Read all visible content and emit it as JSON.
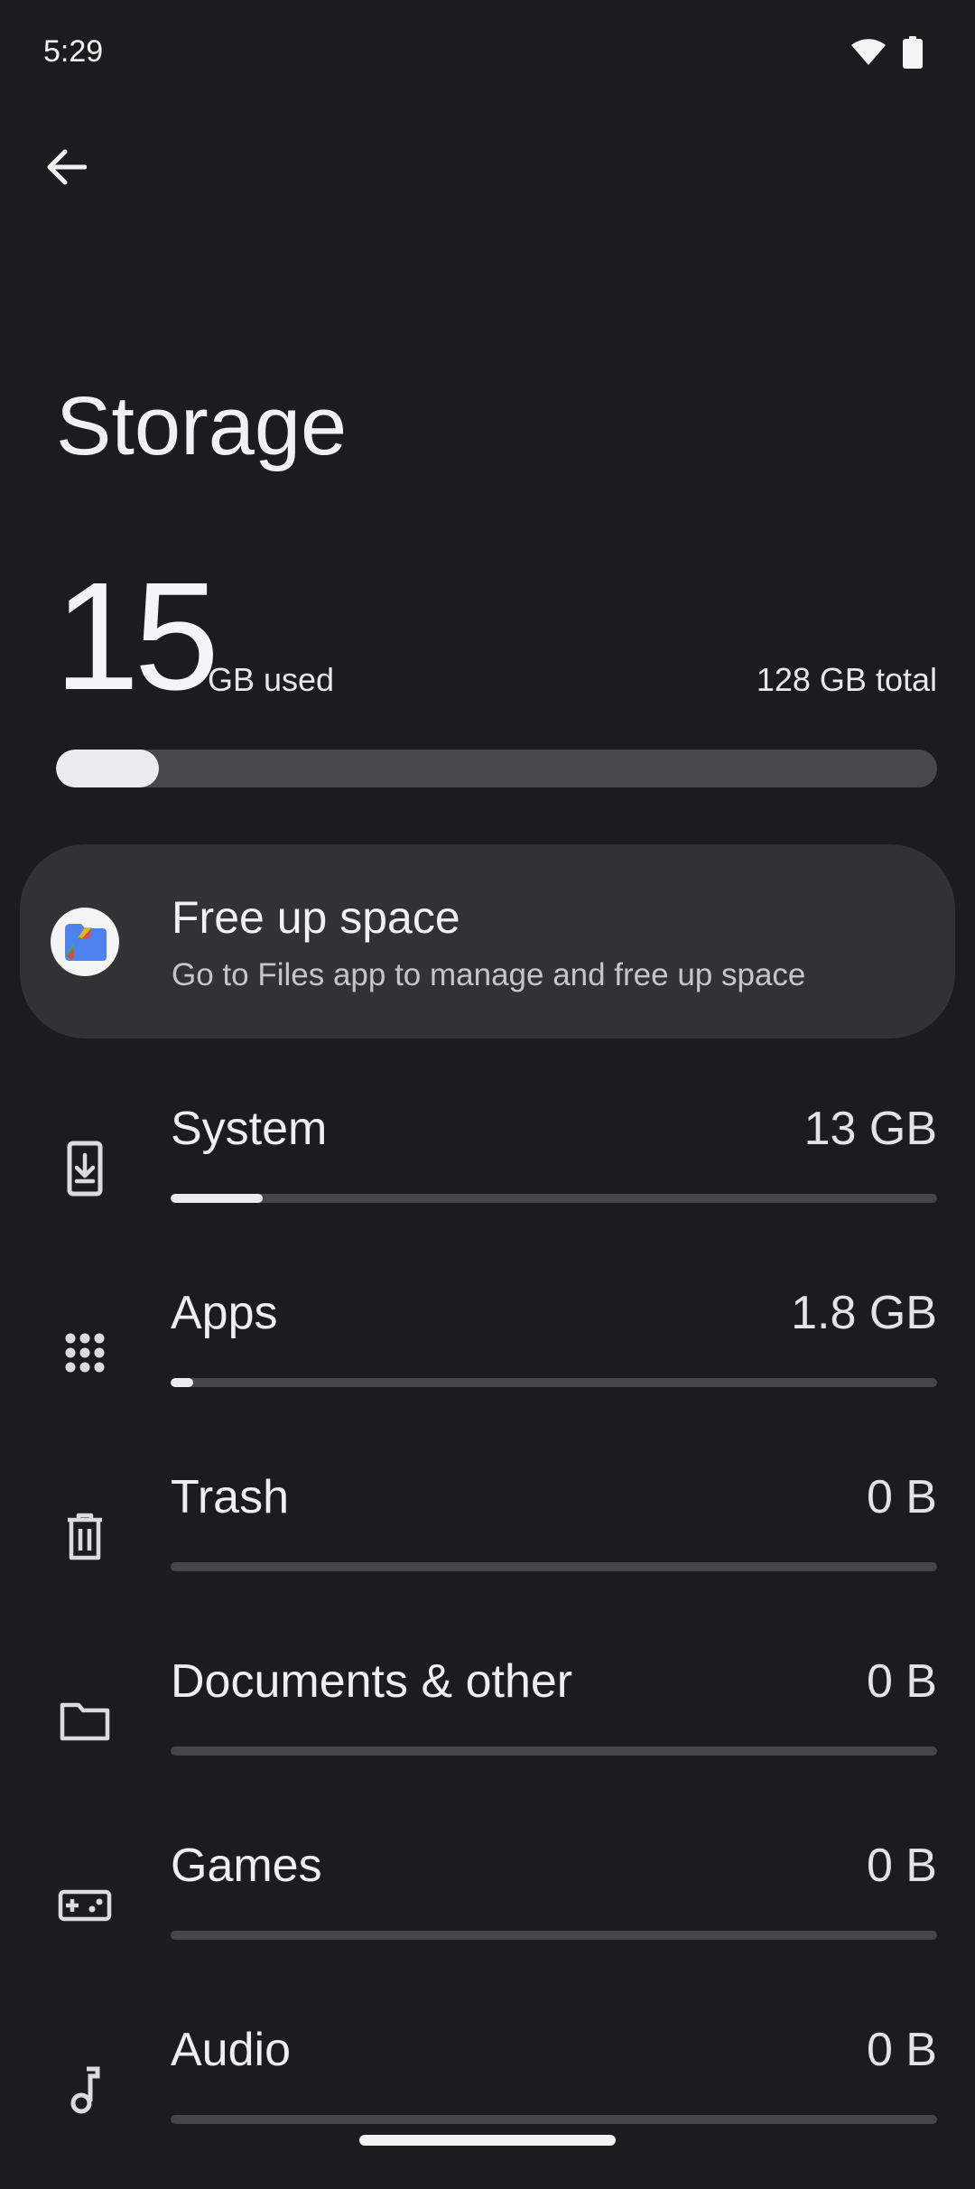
{
  "status_bar": {
    "time": "5:29",
    "icons": [
      "wifi-icon",
      "battery-icon"
    ]
  },
  "nav": {
    "back_icon": "arrow-back-icon"
  },
  "page": {
    "title": "Storage"
  },
  "usage": {
    "used_value": "15",
    "used_unit": "GB used",
    "total": "128 GB total",
    "used_fraction": 0.117
  },
  "free_up": {
    "title": "Free up space",
    "subtitle": "Go to Files app to manage and free up space",
    "icon": "files-app-icon"
  },
  "categories": [
    {
      "label": "System",
      "size": "13 GB",
      "fraction": 0.12,
      "icon": "system-update-icon"
    },
    {
      "label": "Apps",
      "size": "1.8 GB",
      "fraction": 0.03,
      "icon": "apps-grid-icon"
    },
    {
      "label": "Trash",
      "size": "0 B",
      "fraction": 0,
      "icon": "trash-icon"
    },
    {
      "label": "Documents & other",
      "size": "0 B",
      "fraction": 0,
      "icon": "folder-icon"
    },
    {
      "label": "Games",
      "size": "0 B",
      "fraction": 0,
      "icon": "gamepad-icon"
    },
    {
      "label": "Audio",
      "size": "0 B",
      "fraction": 0,
      "icon": "music-note-icon"
    }
  ],
  "colors": {
    "background": "#1c1c1e",
    "card": "#323235",
    "track": "#47484c",
    "fill": "#ececee"
  }
}
